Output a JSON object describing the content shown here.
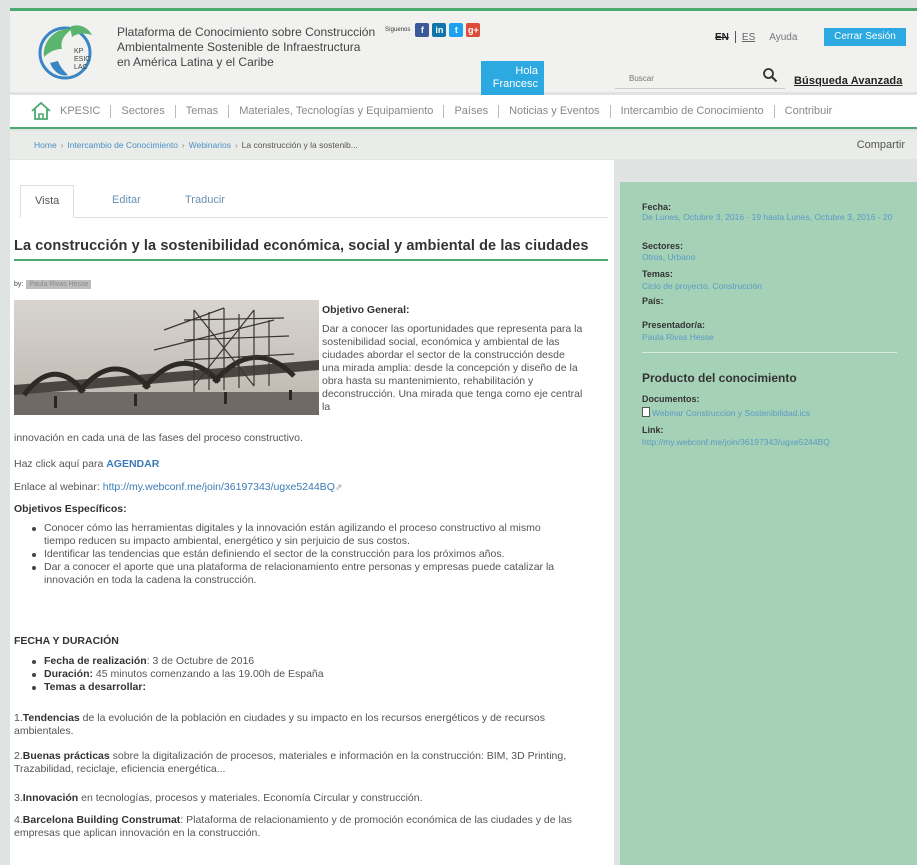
{
  "header": {
    "site_title": "Plataforma de Conocimiento sobre Construcción Ambientalmente Sostenible de Infraestructura en América Latina y el Caribe",
    "logo_text_1": "KP",
    "logo_text_2": "ESIC",
    "logo_text_3": "LAC",
    "social_label": "Síguenos",
    "social": [
      {
        "name": "facebook",
        "glyph": "f",
        "color": "#3b5998"
      },
      {
        "name": "linkedin",
        "glyph": "in",
        "color": "#0e76a8"
      },
      {
        "name": "twitter",
        "glyph": "t",
        "color": "#1da1f2"
      },
      {
        "name": "googleplus",
        "glyph": "g+",
        "color": "#dd4b39"
      }
    ],
    "greeting": "Hola Francesc",
    "lang_en": "EN",
    "lang_es": "ES",
    "help": "Ayuda",
    "logout": "Cerrar Sesión",
    "search_placeholder": "Buscar",
    "advanced_search": "Búsqueda Avanzada",
    "accent": "#2ca9e1",
    "brand_green": "#4daa6f"
  },
  "nav": {
    "items": [
      "KPESIC",
      "Sectores",
      "Temas",
      "Materiales, Tecnologías y Equipamiento",
      "Países",
      "Noticias y Eventos",
      "Intercambio de Conocimiento",
      "Contribuir"
    ]
  },
  "breadcrumb": {
    "items": [
      "Home",
      "Intercambio de Conocimiento",
      "Webinarios"
    ],
    "current": "La construcción y la sostenib...",
    "share": "Compartir"
  },
  "tabs": [
    "Vista",
    "Editar",
    "Traducir"
  ],
  "article": {
    "title": "La construcción y la sostenibilidad económica, social y ambiental de las ciudades",
    "by": "by:",
    "author": "Paula Rivas Hesse",
    "objetivo_general_h": "Objetivo General:",
    "objetivo_general_p": "Dar a conocer las oportunidades que representa para la sostenibilidad social, económica y ambiental de las ciudades abordar el sector de la construcción desde una mirada amplia: desde la concepción y diseño de la obra hasta su mantenimiento, rehabilitación y deconstrucción. Una mirada que tenga como eje central la",
    "objetivo_general_p2": "innovación en cada una de las fases del proceso constructivo.",
    "agenda_prefix": "Haz click aquí para",
    "agenda_link": "AGENDAR",
    "webinar_prefix": "Enlace al webinar:",
    "webinar_url": "http://my.webconf.me/join/36197343/ugxe5244BQ",
    "objetivos_especificos_h": "Objetivos Específicos:",
    "objetivos_especificos": [
      "Conocer cómo las herramientas digitales y la innovación están agilizando el proceso constructivo al mismo tiempo reducen su impacto ambiental, energético y sin perjuicio de sus costos.",
      "Identificar las tendencias que están definiendo el sector de la construcción para los próximos años.",
      "Dar a conocer el aporte que una plataforma de relacionamiento entre personas y empresas puede catalizar la innovación en toda la cadena la construcción."
    ],
    "fecha_h": "FECHA Y DURACIÓN",
    "fecha_items": [
      {
        "label": "Fecha de realización",
        "value": ": 3 de Octubre de 2016"
      },
      {
        "label": "Duración:",
        "value": " 45 minutos comenzando a las 19.00h de España"
      },
      {
        "label": "Temas a desarrollar:",
        "value": ""
      }
    ],
    "temas": [
      {
        "num": "1.",
        "label": "Tendencias",
        "text": " de la evolución de la población en ciudades y su impacto en los recursos energéticos y de recursos ambientales."
      },
      {
        "num": "2.",
        "label": "Buenas prácticas",
        "text": " sobre la digitalización de procesos, materiales e información en la construcción: BIM, 3D Printing, Trazabilidad, reciclaje, eficiencia energética..."
      },
      {
        "num": "3.",
        "label": "Innovación",
        "text": " en tecnologías, procesos y materiales. Economía Circular y construcción."
      },
      {
        "num": "4.",
        "label": "Barcelona Building Construmat",
        "text": ": Plataforma de relacionamiento y de promoción económica de las ciudades y de las empresas que aplican innovación en la construcción."
      }
    ]
  },
  "sidebar": {
    "fecha_label": "Fecha:",
    "fecha_value": "De Lunes, Octubre 3, 2016 - 19 hasta Lunes, Octubre 3, 2016 - 20",
    "sectores_label": "Sectores:",
    "sectores_value": "Otros, Urbano",
    "temas_label": "Temas:",
    "temas_value": "Ciclo de proyecto, Construcción",
    "pais_label": "País:",
    "presentador_label": "Presentador/a:",
    "presentador_value": "Paula Rivas Hesse",
    "producto_h": "Producto del conocimiento",
    "documentos_label": "Documentos:",
    "documento_value": "Webinar Construccion y Sostenibilidad.ics",
    "link_label": "Link:",
    "link_value": "http://my.webconf.me/join/36197343/ugxe5244BQ"
  }
}
